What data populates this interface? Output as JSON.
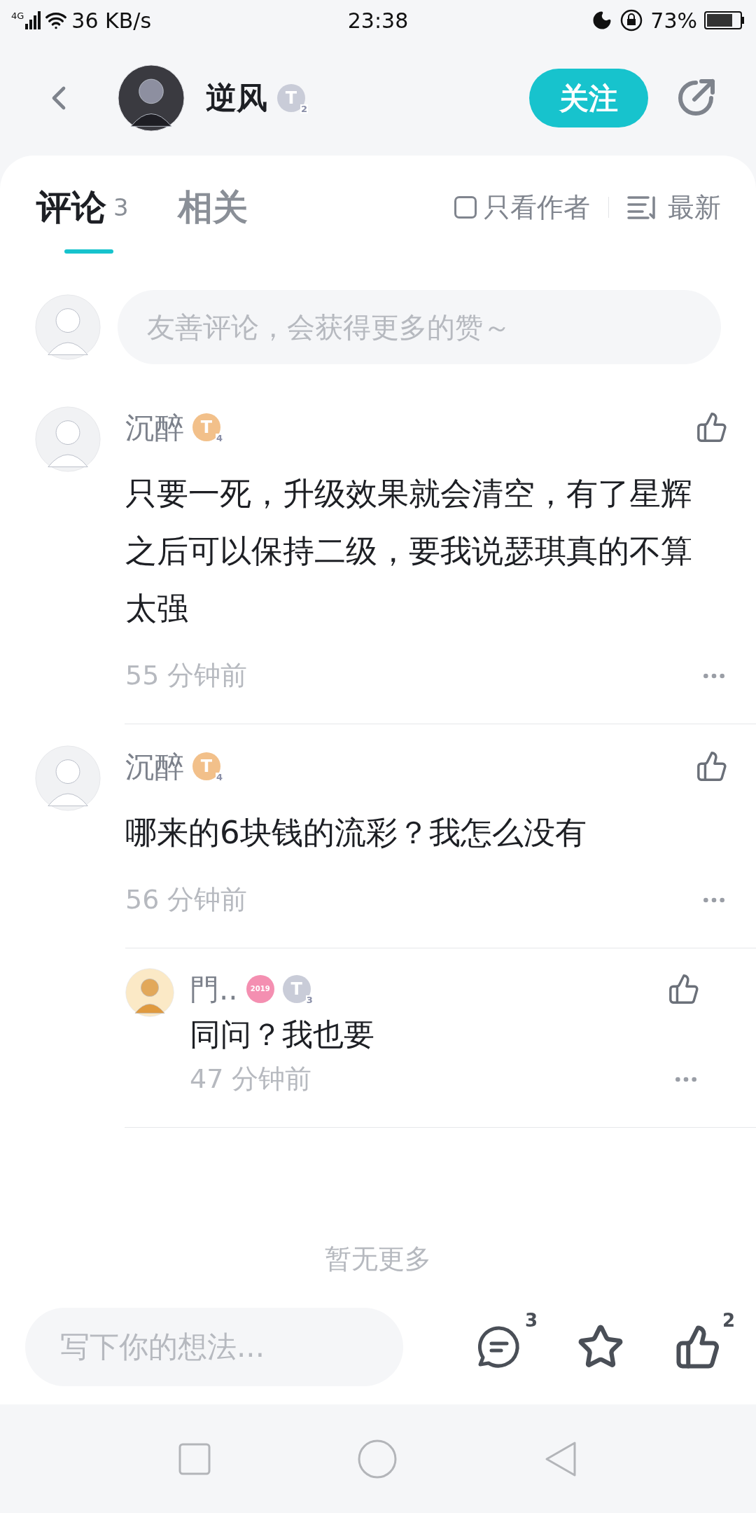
{
  "status_bar": {
    "network": "4G",
    "speed": "36 KB/s",
    "time": "23:38",
    "battery": "73%"
  },
  "header": {
    "author": "逆风",
    "badge": {
      "letter": "T",
      "number": "2",
      "color": "#c9ccd8"
    },
    "follow_button": "关注"
  },
  "tabs": [
    {
      "label": "评论",
      "count": "3",
      "selected": true
    },
    {
      "label": "相关",
      "selected": false
    }
  ],
  "filters": {
    "author_only": {
      "label": "只看作者",
      "checked": false
    },
    "sort": {
      "label": "最新"
    }
  },
  "comment_input": {
    "placeholder": "友善评论，会获得更多的赞～"
  },
  "comments": [
    {
      "name": "沉醉",
      "badges": [
        {
          "kind": "level",
          "letter": "T",
          "number": "4",
          "color": "#f2c08a"
        }
      ],
      "text": "只要一死，升级效果就会清空，有了星辉之后可以保持二级，要我说瑟琪真的不算太强",
      "time": "55 分钟前"
    },
    {
      "name": "沉醉",
      "badges": [
        {
          "kind": "level",
          "letter": "T",
          "number": "4",
          "color": "#f2c08a"
        }
      ],
      "text": "哪来的6块钱的流彩？我怎么没有",
      "time": "56 分钟前",
      "replies": [
        {
          "name": "門..",
          "badges": [
            {
              "kind": "event",
              "text": "2019",
              "color": "#f48fb1"
            },
            {
              "kind": "level",
              "letter": "T",
              "number": "3",
              "color": "#c9ccd8"
            }
          ],
          "text": "同问？我也要",
          "time": "47 分钟前"
        }
      ]
    }
  ],
  "end_text": "暂无更多",
  "bottom_bar": {
    "placeholder": "写下你的想法...",
    "comment_count": "3",
    "like_count": "2"
  }
}
